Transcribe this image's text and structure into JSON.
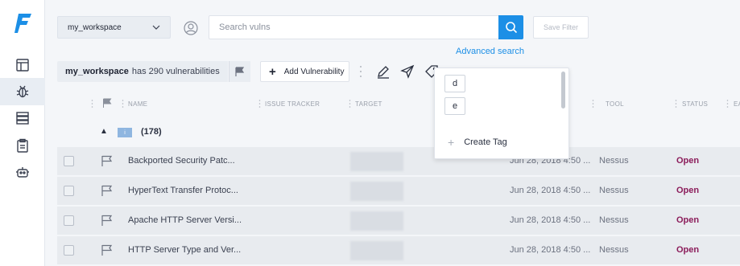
{
  "sidebar": {
    "logo": "F",
    "items": [
      {
        "icon": "dashboard-icon"
      },
      {
        "icon": "bug-icon"
      },
      {
        "icon": "servers-icon"
      },
      {
        "icon": "clipboard-icon"
      },
      {
        "icon": "robot-icon"
      }
    ]
  },
  "topbar": {
    "workspace": "my_workspace",
    "search_placeholder": "Search vulns",
    "save_filter": "Save Filter",
    "advanced_search": "Advanced search"
  },
  "toolbar": {
    "workspace_name": "my_workspace",
    "count_text": "has 290 vulnerabilities",
    "add_vulnerability": "Add Vulnerability"
  },
  "table": {
    "columns": [
      "NAME",
      "ISSUE TRACKER",
      "TARGET",
      "TOOL",
      "STATUS",
      "EA"
    ],
    "group": {
      "severity_badge": "i",
      "count": "(178)"
    },
    "rows": [
      {
        "name": "Backported Security Patc...",
        "date": "Jun 28, 2018 4:50 ...",
        "tool": "Nessus",
        "status": "Open"
      },
      {
        "name": "HyperText Transfer Protoc...",
        "date": "Jun 28, 2018 4:50 ...",
        "tool": "Nessus",
        "status": "Open"
      },
      {
        "name": "Apache HTTP Server Versi...",
        "date": "Jun 28, 2018 4:50 ...",
        "tool": "Nessus",
        "status": "Open"
      },
      {
        "name": "HTTP Server Type and Ver...",
        "date": "Jun 28, 2018 4:50 ...",
        "tool": "Nessus",
        "status": "Open"
      }
    ]
  },
  "tag_popup": {
    "tags": [
      "d",
      "e"
    ],
    "create_label": "Create Tag"
  },
  "colors": {
    "accent": "#1c8fe6",
    "status_open": "#8b1c5a",
    "logo": "#1c8fe6"
  }
}
